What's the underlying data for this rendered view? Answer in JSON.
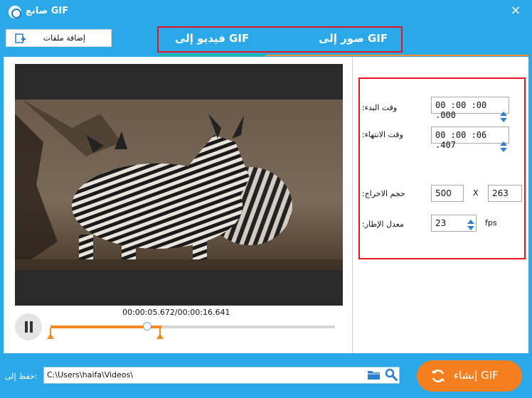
{
  "window": {
    "title": "صانع GIF",
    "close_icon": "×"
  },
  "toolbar": {
    "add_files_label": "إضافة ملفات"
  },
  "tabs": [
    {
      "label": "فيديو إلى GIF",
      "active": true
    },
    {
      "label": "صور إلى GIF",
      "active": false
    }
  ],
  "player": {
    "time_display": "00:00:05.672/00:00:16.641",
    "progress_fraction": 0.34,
    "trim_start_fraction": 0.0,
    "trim_end_fraction": 0.39
  },
  "settings": {
    "start_time_label": "وقت البدء:",
    "start_time_value": "00 :00 :00 .000",
    "end_time_label": "وقت الانتهاء:",
    "end_time_value": "00 :00 :06 .407",
    "output_size_label": "حجم الاخراج:",
    "width_value": "500",
    "times_sign": "X",
    "height_value": "263",
    "frame_rate_label": "معدل الإطار:",
    "fps_value": "23",
    "fps_unit": "fps"
  },
  "footer": {
    "save_to_label": "حفظ إلى:",
    "path_value": "C:\\Users\\haifa\\Videos\\",
    "create_gif_label": "إنشاء GIF"
  },
  "colors": {
    "accent": "#2aa8e8",
    "orange": "#f57e1f",
    "highlight_red": "#e8141e"
  }
}
